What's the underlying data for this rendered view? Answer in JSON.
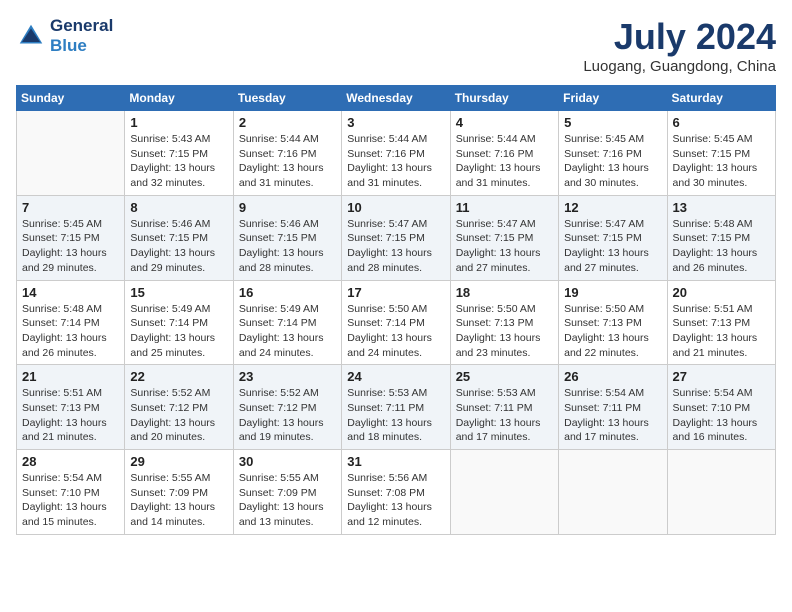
{
  "header": {
    "logo_line1": "General",
    "logo_line2": "Blue",
    "month_year": "July 2024",
    "location": "Luogang, Guangdong, China"
  },
  "weekdays": [
    "Sunday",
    "Monday",
    "Tuesday",
    "Wednesday",
    "Thursday",
    "Friday",
    "Saturday"
  ],
  "weeks": [
    [
      {
        "day": "",
        "info": ""
      },
      {
        "day": "1",
        "info": "Sunrise: 5:43 AM\nSunset: 7:15 PM\nDaylight: 13 hours\nand 32 minutes."
      },
      {
        "day": "2",
        "info": "Sunrise: 5:44 AM\nSunset: 7:16 PM\nDaylight: 13 hours\nand 31 minutes."
      },
      {
        "day": "3",
        "info": "Sunrise: 5:44 AM\nSunset: 7:16 PM\nDaylight: 13 hours\nand 31 minutes."
      },
      {
        "day": "4",
        "info": "Sunrise: 5:44 AM\nSunset: 7:16 PM\nDaylight: 13 hours\nand 31 minutes."
      },
      {
        "day": "5",
        "info": "Sunrise: 5:45 AM\nSunset: 7:16 PM\nDaylight: 13 hours\nand 30 minutes."
      },
      {
        "day": "6",
        "info": "Sunrise: 5:45 AM\nSunset: 7:15 PM\nDaylight: 13 hours\nand 30 minutes."
      }
    ],
    [
      {
        "day": "7",
        "info": "Sunrise: 5:45 AM\nSunset: 7:15 PM\nDaylight: 13 hours\nand 29 minutes."
      },
      {
        "day": "8",
        "info": "Sunrise: 5:46 AM\nSunset: 7:15 PM\nDaylight: 13 hours\nand 29 minutes."
      },
      {
        "day": "9",
        "info": "Sunrise: 5:46 AM\nSunset: 7:15 PM\nDaylight: 13 hours\nand 28 minutes."
      },
      {
        "day": "10",
        "info": "Sunrise: 5:47 AM\nSunset: 7:15 PM\nDaylight: 13 hours\nand 28 minutes."
      },
      {
        "day": "11",
        "info": "Sunrise: 5:47 AM\nSunset: 7:15 PM\nDaylight: 13 hours\nand 27 minutes."
      },
      {
        "day": "12",
        "info": "Sunrise: 5:47 AM\nSunset: 7:15 PM\nDaylight: 13 hours\nand 27 minutes."
      },
      {
        "day": "13",
        "info": "Sunrise: 5:48 AM\nSunset: 7:15 PM\nDaylight: 13 hours\nand 26 minutes."
      }
    ],
    [
      {
        "day": "14",
        "info": "Sunrise: 5:48 AM\nSunset: 7:14 PM\nDaylight: 13 hours\nand 26 minutes."
      },
      {
        "day": "15",
        "info": "Sunrise: 5:49 AM\nSunset: 7:14 PM\nDaylight: 13 hours\nand 25 minutes."
      },
      {
        "day": "16",
        "info": "Sunrise: 5:49 AM\nSunset: 7:14 PM\nDaylight: 13 hours\nand 24 minutes."
      },
      {
        "day": "17",
        "info": "Sunrise: 5:50 AM\nSunset: 7:14 PM\nDaylight: 13 hours\nand 24 minutes."
      },
      {
        "day": "18",
        "info": "Sunrise: 5:50 AM\nSunset: 7:13 PM\nDaylight: 13 hours\nand 23 minutes."
      },
      {
        "day": "19",
        "info": "Sunrise: 5:50 AM\nSunset: 7:13 PM\nDaylight: 13 hours\nand 22 minutes."
      },
      {
        "day": "20",
        "info": "Sunrise: 5:51 AM\nSunset: 7:13 PM\nDaylight: 13 hours\nand 21 minutes."
      }
    ],
    [
      {
        "day": "21",
        "info": "Sunrise: 5:51 AM\nSunset: 7:13 PM\nDaylight: 13 hours\nand 21 minutes."
      },
      {
        "day": "22",
        "info": "Sunrise: 5:52 AM\nSunset: 7:12 PM\nDaylight: 13 hours\nand 20 minutes."
      },
      {
        "day": "23",
        "info": "Sunrise: 5:52 AM\nSunset: 7:12 PM\nDaylight: 13 hours\nand 19 minutes."
      },
      {
        "day": "24",
        "info": "Sunrise: 5:53 AM\nSunset: 7:11 PM\nDaylight: 13 hours\nand 18 minutes."
      },
      {
        "day": "25",
        "info": "Sunrise: 5:53 AM\nSunset: 7:11 PM\nDaylight: 13 hours\nand 17 minutes."
      },
      {
        "day": "26",
        "info": "Sunrise: 5:54 AM\nSunset: 7:11 PM\nDaylight: 13 hours\nand 17 minutes."
      },
      {
        "day": "27",
        "info": "Sunrise: 5:54 AM\nSunset: 7:10 PM\nDaylight: 13 hours\nand 16 minutes."
      }
    ],
    [
      {
        "day": "28",
        "info": "Sunrise: 5:54 AM\nSunset: 7:10 PM\nDaylight: 13 hours\nand 15 minutes."
      },
      {
        "day": "29",
        "info": "Sunrise: 5:55 AM\nSunset: 7:09 PM\nDaylight: 13 hours\nand 14 minutes."
      },
      {
        "day": "30",
        "info": "Sunrise: 5:55 AM\nSunset: 7:09 PM\nDaylight: 13 hours\nand 13 minutes."
      },
      {
        "day": "31",
        "info": "Sunrise: 5:56 AM\nSunset: 7:08 PM\nDaylight: 13 hours\nand 12 minutes."
      },
      {
        "day": "",
        "info": ""
      },
      {
        "day": "",
        "info": ""
      },
      {
        "day": "",
        "info": ""
      }
    ]
  ]
}
